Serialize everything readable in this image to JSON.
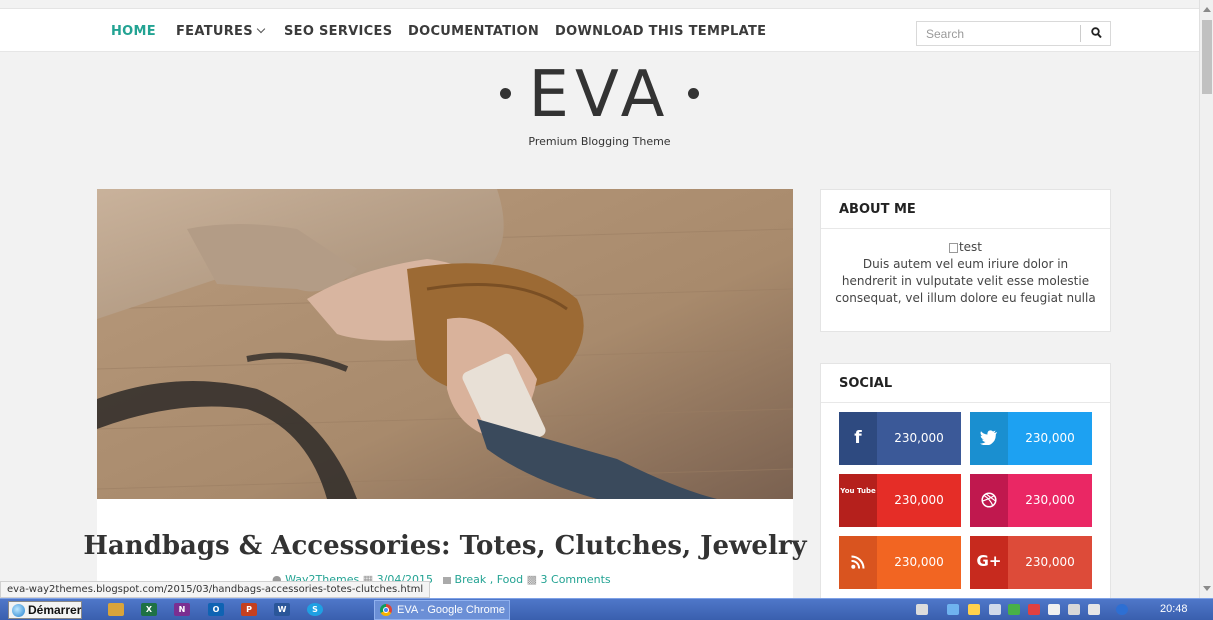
{
  "nav": {
    "items": [
      {
        "label": "HOME",
        "active": true
      },
      {
        "label": "FEATURES",
        "has_dropdown": true
      },
      {
        "label": "SEO SERVICES"
      },
      {
        "label": "DOCUMENTATION"
      },
      {
        "label": "DOWNLOAD THIS TEMPLATE"
      }
    ],
    "search_placeholder": "Search",
    "accent_color": "#23a393"
  },
  "masthead": {
    "logo": "EVA",
    "tagline": "Premium Blogging Theme"
  },
  "post": {
    "title": "Handbags & Accessories: Totes, Clutches, Jewelry",
    "author": "Way2Themes",
    "date": "3/04/2015",
    "categories": "Break , Food",
    "comments": "3 Comments"
  },
  "sidebar": {
    "about": {
      "title": "ABOUT ME",
      "image_alt": "test",
      "text": "Duis autem vel eum iriure dolor in hendrerit in vulputate velit esse molestie consequat, vel illum dolore eu feugiat nulla"
    },
    "social": {
      "title": "SOCIAL",
      "items": [
        {
          "network": "facebook",
          "icon": "f",
          "count": "230,000",
          "icon_color": "#2e4a80",
          "color": "#3b5998"
        },
        {
          "network": "twitter",
          "icon": "twitter-bird",
          "count": "230,000",
          "icon_color": "#1a8fd0",
          "color": "#1da1f2"
        },
        {
          "network": "youtube",
          "icon": "You Tube",
          "count": "230,000",
          "icon_color": "#b5201c",
          "color": "#e52d27"
        },
        {
          "network": "dribbble",
          "icon": "dribbble-ball",
          "count": "230,000",
          "icon_color": "#c0184e",
          "color": "#ea2764"
        },
        {
          "network": "rss",
          "icon": "rss-waves",
          "count": "230,000",
          "icon_color": "#d9541f",
          "color": "#f26522"
        },
        {
          "network": "google-plus",
          "icon": "G+",
          "count": "230,000",
          "icon_color": "#c72a1e",
          "color": "#dd4b39"
        }
      ]
    }
  },
  "status_url": "eva-way2themes.blogspot.com/2015/03/handbags-accessories-totes-clutches.html",
  "taskbar": {
    "start_label": "Démarrer",
    "active_task": "EVA - Google Chrome",
    "clock": "20:48"
  }
}
